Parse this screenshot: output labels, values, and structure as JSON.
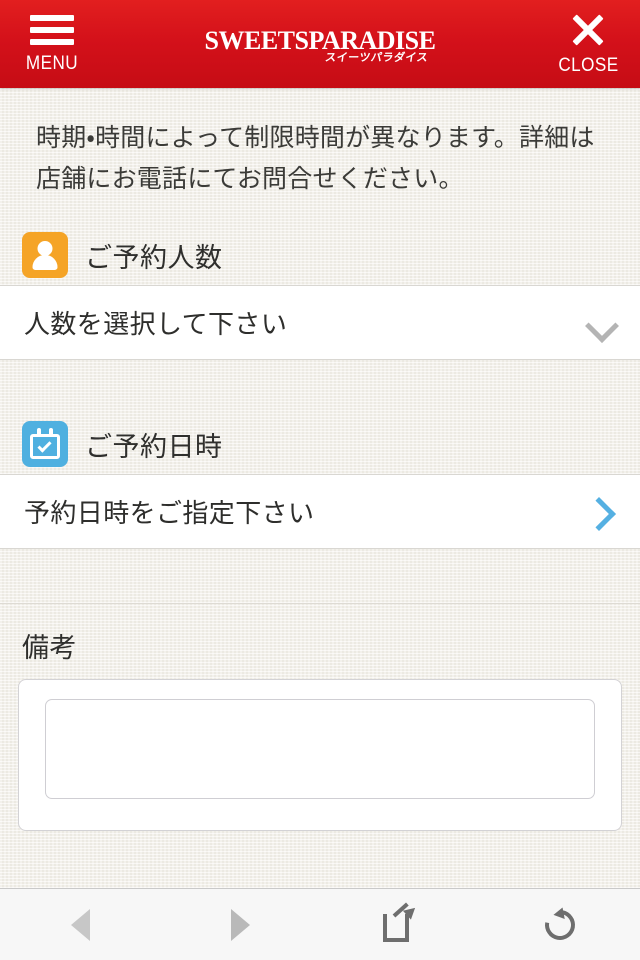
{
  "header": {
    "menu_label": "MENU",
    "close_label": "CLOSE",
    "logo_main": "SweetsParadise",
    "logo_sub": "スイーツパラダイス",
    "brand_color": "#d4111a",
    "menu_icon": "hamburger-icon",
    "close_icon": "close-x-icon"
  },
  "notice": {
    "text": "時期・時間によって制限時間が異なります。詳細は店舗にお電話にてお問合せください。"
  },
  "sections": {
    "party_size": {
      "icon": "person-icon",
      "icon_color": "#f5a427",
      "title": "ご予約人数",
      "field_value": "人数を選択して下さい",
      "chevron": "chevron-down-icon",
      "chevron_color": "#b4b4b4"
    },
    "datetime": {
      "icon": "calendar-check-icon",
      "icon_color": "#4fb0e0",
      "title": "ご予約日時",
      "field_value": "予約日時をご指定下さい",
      "chevron": "chevron-right-icon",
      "chevron_color": "#55b0e2"
    },
    "remarks": {
      "title": "備考",
      "textarea_value": "",
      "textarea_placeholder": ""
    }
  },
  "toolbar": {
    "back_icon": "back-triangle-icon",
    "forward_icon": "forward-triangle-icon",
    "share_icon": "share-icon",
    "reload_icon": "reload-icon"
  }
}
